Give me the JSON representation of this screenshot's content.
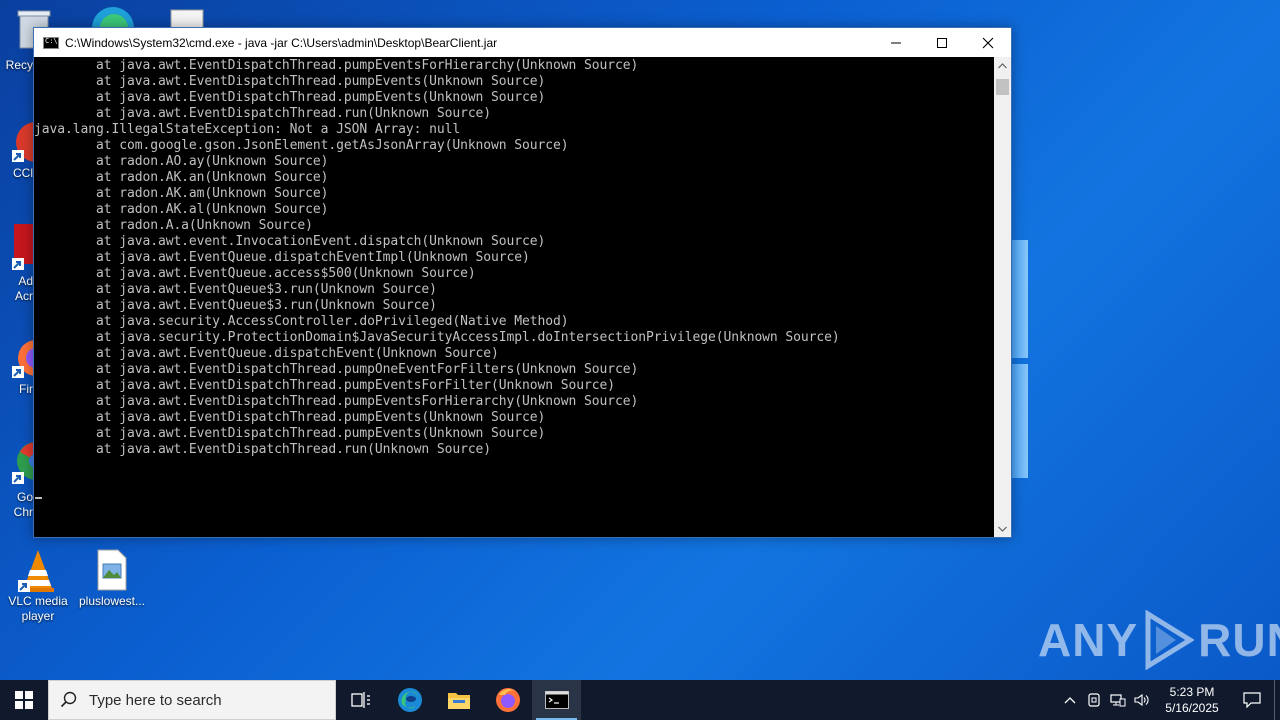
{
  "window": {
    "title": "C:\\Windows\\System32\\cmd.exe - java  -jar C:\\Users\\admin\\Desktop\\BearClient.jar",
    "minimize_label": "—",
    "maximize_label": "☐",
    "close_label": "✕"
  },
  "console": {
    "lines": [
      "        at java.awt.EventDispatchThread.pumpEventsForHierarchy(Unknown Source)",
      "        at java.awt.EventDispatchThread.pumpEvents(Unknown Source)",
      "        at java.awt.EventDispatchThread.pumpEvents(Unknown Source)",
      "        at java.awt.EventDispatchThread.run(Unknown Source)",
      "java.lang.IllegalStateException: Not a JSON Array: null",
      "        at com.google.gson.JsonElement.getAsJsonArray(Unknown Source)",
      "        at radon.AO.ay(Unknown Source)",
      "        at radon.AK.an(Unknown Source)",
      "        at radon.AK.am(Unknown Source)",
      "        at radon.AK.al(Unknown Source)",
      "        at radon.A.a(Unknown Source)",
      "        at java.awt.event.InvocationEvent.dispatch(Unknown Source)",
      "        at java.awt.EventQueue.dispatchEventImpl(Unknown Source)",
      "        at java.awt.EventQueue.access$500(Unknown Source)",
      "        at java.awt.EventQueue$3.run(Unknown Source)",
      "        at java.awt.EventQueue$3.run(Unknown Source)",
      "        at java.security.AccessController.doPrivileged(Native Method)",
      "        at java.security.ProtectionDomain$JavaSecurityAccessImpl.doIntersectionPrivilege(Unknown Source)",
      "        at java.awt.EventQueue.dispatchEvent(Unknown Source)",
      "        at java.awt.EventDispatchThread.pumpOneEventForFilters(Unknown Source)",
      "        at java.awt.EventDispatchThread.pumpEventsForFilter(Unknown Source)",
      "        at java.awt.EventDispatchThread.pumpEventsForHierarchy(Unknown Source)",
      "        at java.awt.EventDispatchThread.pumpEvents(Unknown Source)",
      "        at java.awt.EventDispatchThread.pumpEvents(Unknown Source)",
      "        at java.awt.EventDispatchThread.run(Unknown Source)"
    ]
  },
  "desktop": {
    "partial_labels": [
      "Recy",
      "CCl",
      "Ad",
      "Acr",
      "Fir",
      "Go",
      "Chr"
    ],
    "icons": [
      {
        "label": "VLC media player",
        "icon": "vlc-icon"
      },
      {
        "label": "pluslowest...",
        "icon": "image-file-icon"
      }
    ]
  },
  "taskbar": {
    "search_placeholder": "Type here to search",
    "apps": [
      "task-view-icon",
      "edge-icon",
      "file-explorer-icon",
      "firefox-icon",
      "cmd-icon"
    ],
    "clock_time": "5:23 PM",
    "clock_date": "5/16/2025"
  },
  "watermark": {
    "text_left": "ANY",
    "text_right": "RUN"
  },
  "colors": {
    "console_bg": "#000000",
    "console_fg": "#c0c0c0",
    "taskbar_bg": "#101a2c",
    "desktop_blue": "#0b5fd0"
  }
}
